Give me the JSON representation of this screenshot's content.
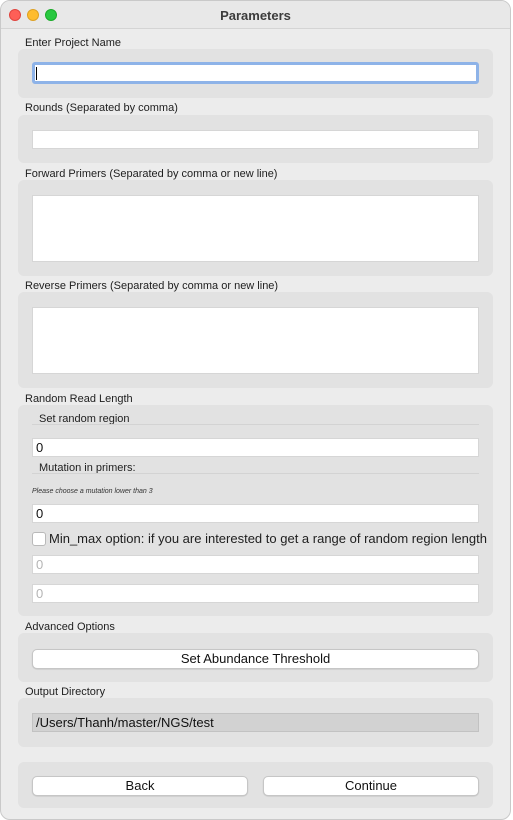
{
  "window": {
    "title": "Parameters"
  },
  "project": {
    "label": "Enter Project Name",
    "value": ""
  },
  "rounds": {
    "label": "Rounds (Separated by comma)",
    "value": ""
  },
  "forward": {
    "label": "Forward Primers (Separated by comma or new line)",
    "value": ""
  },
  "reverse": {
    "label": "Reverse Primers (Separated by comma or new line)",
    "value": ""
  },
  "random": {
    "label": "Random Read Length",
    "region_label": "Set random region",
    "region_value": "0",
    "mutation_label": "Mutation in primers:",
    "mutation_note": "Please choose a mutation lower than 3",
    "mutation_value": "0",
    "minmax_label": "Min_max option: if you are interested to get a range of random region length",
    "min_value": "0",
    "max_value": "0"
  },
  "advanced": {
    "label": "Advanced Options",
    "button": "Set Abundance Threshold"
  },
  "output": {
    "label": "Output Directory",
    "value": "/Users/Thanh/master/NGS/test"
  },
  "nav": {
    "back": "Back",
    "continue": "Continue"
  }
}
